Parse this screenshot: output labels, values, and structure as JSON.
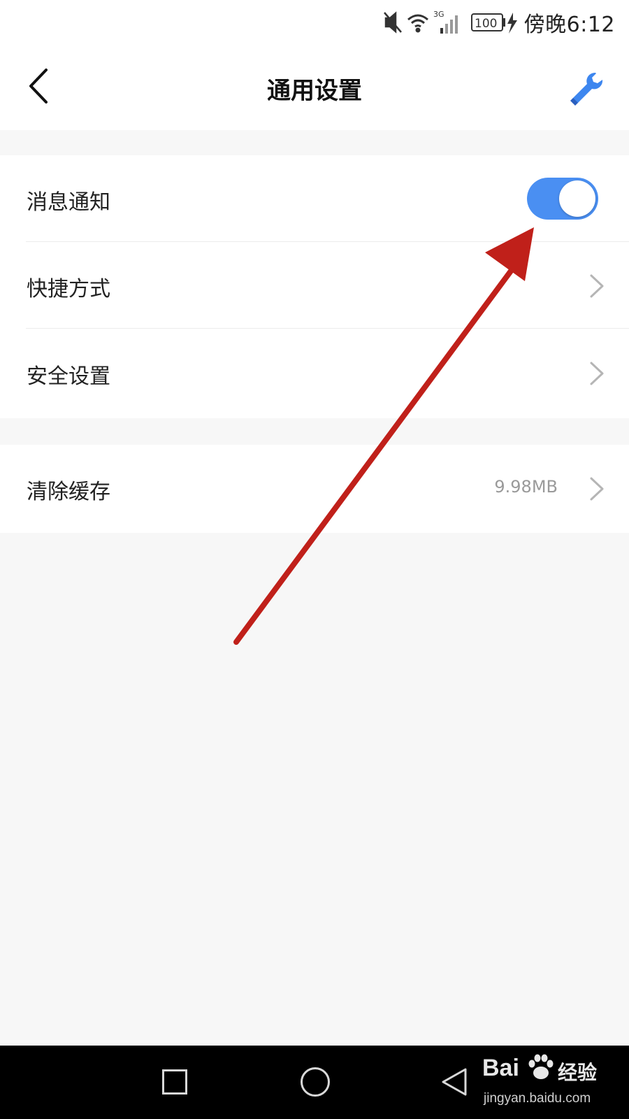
{
  "status_bar": {
    "time": "傍晚6:12",
    "network": "3G",
    "battery": "100",
    "icons": [
      "mute-icon",
      "wifi-icon",
      "signal-icon",
      "battery-icon",
      "charging-icon"
    ]
  },
  "header": {
    "title": "通用设置",
    "back_icon": "chevron-left-icon",
    "tool_icon": "wrench-icon"
  },
  "settings": {
    "group1": [
      {
        "label": "消息通知",
        "control": "toggle",
        "enabled": true
      },
      {
        "label": "快捷方式",
        "control": "chevron"
      },
      {
        "label": "安全设置",
        "control": "chevron"
      }
    ],
    "group2": [
      {
        "label": "清除缓存",
        "value": "9.98MB",
        "control": "chevron"
      }
    ]
  },
  "nav_bar": {
    "buttons": [
      "recents-icon",
      "home-icon",
      "back-triangle-icon"
    ]
  },
  "watermark": {
    "brand": "Bai",
    "brand_cn": "经验",
    "url": "jingyan.baidu.com"
  },
  "colors": {
    "accent": "#4a8ff2",
    "annotation_arrow": "#c0201a",
    "background": "#f7f7f7",
    "secondary_text": "#9a9a9a"
  }
}
